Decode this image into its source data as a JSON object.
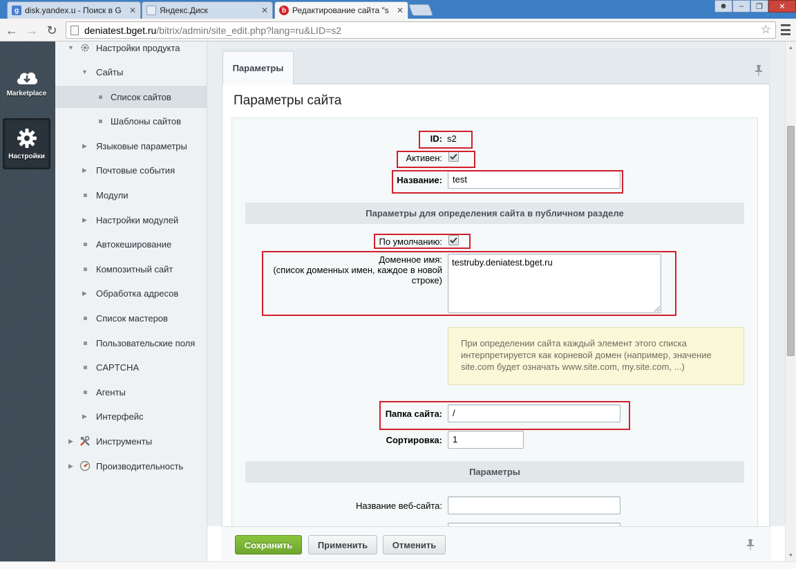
{
  "browser": {
    "tabs": [
      {
        "label": "disk.yandex.u - Поиск в G",
        "favicon": "google-icon"
      },
      {
        "label": "Яндекс.Диск",
        "favicon": "page-icon"
      },
      {
        "label": "Редактирование сайта \"s",
        "favicon": "bitrix-icon"
      }
    ],
    "url_host": "deniatest.bget.ru",
    "url_path": "/bitrix/admin/site_edit.php?lang=ru&LID=s2"
  },
  "leftbar": {
    "marketplace_label": "Marketplace",
    "settings_label": "Настройки"
  },
  "menu": {
    "product_settings": "Настройки продукта",
    "sites": "Сайты",
    "site_list": "Список сайтов",
    "site_templates": "Шаблоны сайтов",
    "language_params": "Языковые параметры",
    "mail_events": "Почтовые события",
    "modules": "Модули",
    "module_settings": "Настройки модулей",
    "autocache": "Автокеширование",
    "composite": "Композитный сайт",
    "url_processing": "Обработка адресов",
    "wizards": "Список мастеров",
    "user_fields": "Пользовательские поля",
    "captcha": "CAPTCHA",
    "agents": "Агенты",
    "interface": "Интерфейс",
    "tools": "Инструменты",
    "performance": "Производительность"
  },
  "content": {
    "tab_label": "Параметры",
    "panel_title": "Параметры сайта",
    "id_label": "ID:",
    "id_value": "s2",
    "active_label": "Активен:",
    "name_label": "Название:",
    "name_value": "test",
    "section_public": "Параметры для определения сайта в публичном разделе",
    "default_label": "По умолчанию:",
    "domain_label_1": "Доменное имя:",
    "domain_label_2": "(список доменных имен, каждое в новой строке)",
    "domain_value": "testruby.deniatest.bget.ru",
    "note_text": "При определении сайта каждый элемент этого списка интерпретируется как корневой домен (например, значение site.com будет означать www.site.com, my.site.com, ...)",
    "folder_label": "Папка сайта:",
    "folder_value": "/",
    "sort_label": "Сортировка:",
    "sort_value": "1",
    "section_params": "Параметры",
    "website_name_label": "Название веб-сайта:",
    "website_name_value": ""
  },
  "actions": {
    "save": "Сохранить",
    "apply": "Применить",
    "cancel": "Отменить"
  },
  "colors": {
    "highlight": "#d21f2e",
    "save_button": "#7ab536",
    "sidebar_dark": "#3f4b56"
  }
}
